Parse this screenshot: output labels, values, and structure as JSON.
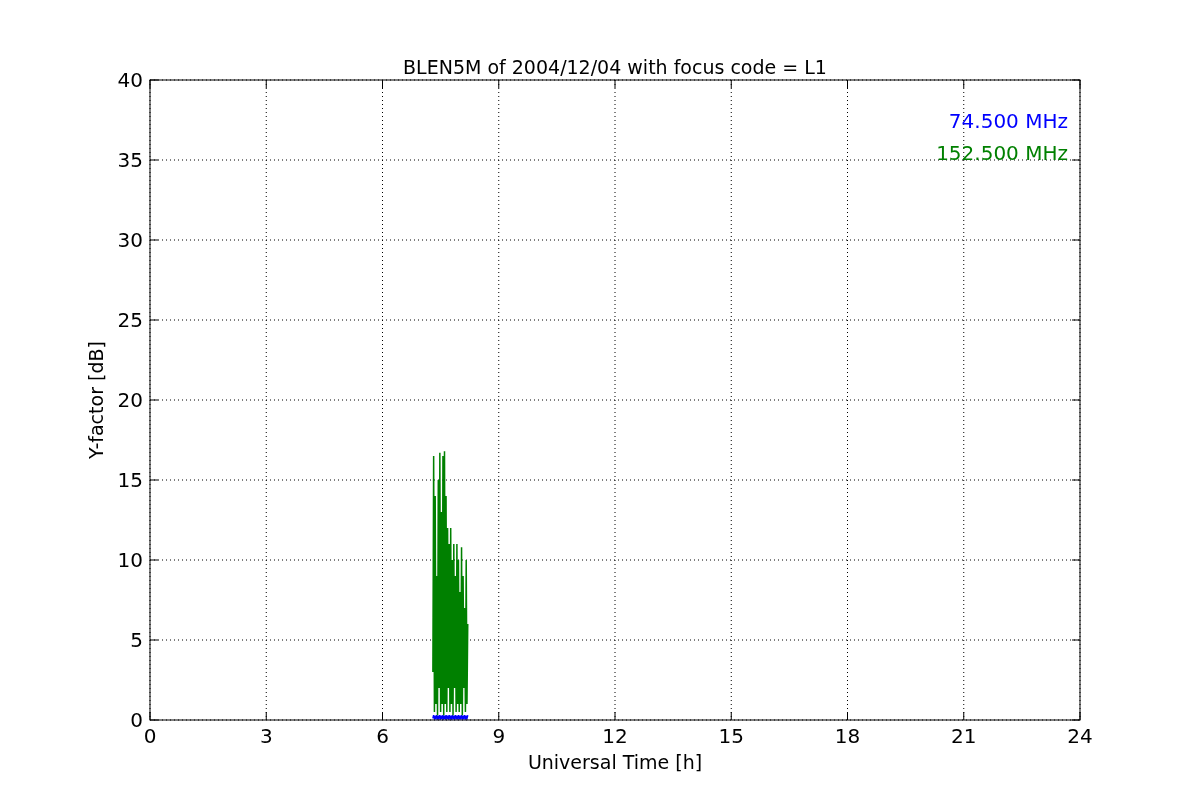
{
  "chart_data": {
    "type": "line",
    "title": "BLEN5M of 2004/12/04 with focus code = L1",
    "xlabel": "Universal Time [h]",
    "ylabel": "Y-factor [dB]",
    "x": [
      7.3,
      7.32,
      7.34,
      7.36,
      7.38,
      7.4,
      7.42,
      7.44,
      7.46,
      7.48,
      7.5,
      7.52,
      7.54,
      7.56,
      7.58,
      7.6,
      7.62,
      7.64,
      7.66,
      7.68,
      7.7,
      7.72,
      7.74,
      7.76,
      7.78,
      7.8,
      7.82,
      7.84,
      7.86,
      7.88,
      7.9,
      7.92,
      7.94,
      7.96,
      7.98,
      8.0,
      8.02,
      8.04,
      8.06,
      8.08,
      8.1,
      8.12,
      8.14,
      8.16,
      8.18,
      8.2
    ],
    "series": [
      {
        "name": "74.500 MHz",
        "color": "#0000ff",
        "values": [
          0.1,
          0.3,
          0.1,
          0.2,
          0.1,
          0.3,
          0.1,
          0.2,
          0.1,
          0.3,
          0.1,
          0.2,
          0.1,
          0.3,
          0.1,
          0.2,
          0.1,
          0.3,
          0.1,
          0.2,
          0.1,
          0.3,
          0.1,
          0.2,
          0.1,
          0.3,
          0.1,
          0.2,
          0.1,
          0.3,
          0.1,
          0.2,
          0.1,
          0.3,
          0.1,
          0.2,
          0.1,
          0.3,
          0.1,
          0.2,
          0.1,
          0.3,
          0.1,
          0.2,
          0.1,
          0.3
        ]
      },
      {
        "name": "152.500 MHz",
        "color": "#008000",
        "values": [
          3,
          16.5,
          0.5,
          14,
          1,
          9,
          0.3,
          15,
          2,
          16.7,
          0.5,
          13,
          1,
          16.5,
          0.3,
          16.8,
          1,
          14,
          0.5,
          12,
          2,
          11,
          0.5,
          12,
          1,
          10,
          0.3,
          11,
          2,
          9,
          0.5,
          11,
          1,
          10,
          0.5,
          8,
          1,
          10.8,
          0.3,
          9,
          2,
          7,
          0.5,
          10,
          1,
          6
        ]
      }
    ],
    "xlim": [
      0,
      24
    ],
    "ylim": [
      0,
      40
    ],
    "xticks": [
      0,
      3,
      6,
      9,
      12,
      15,
      18,
      21,
      24
    ],
    "yticks": [
      0,
      5,
      10,
      15,
      20,
      25,
      30,
      35,
      40
    ],
    "grid": true
  }
}
